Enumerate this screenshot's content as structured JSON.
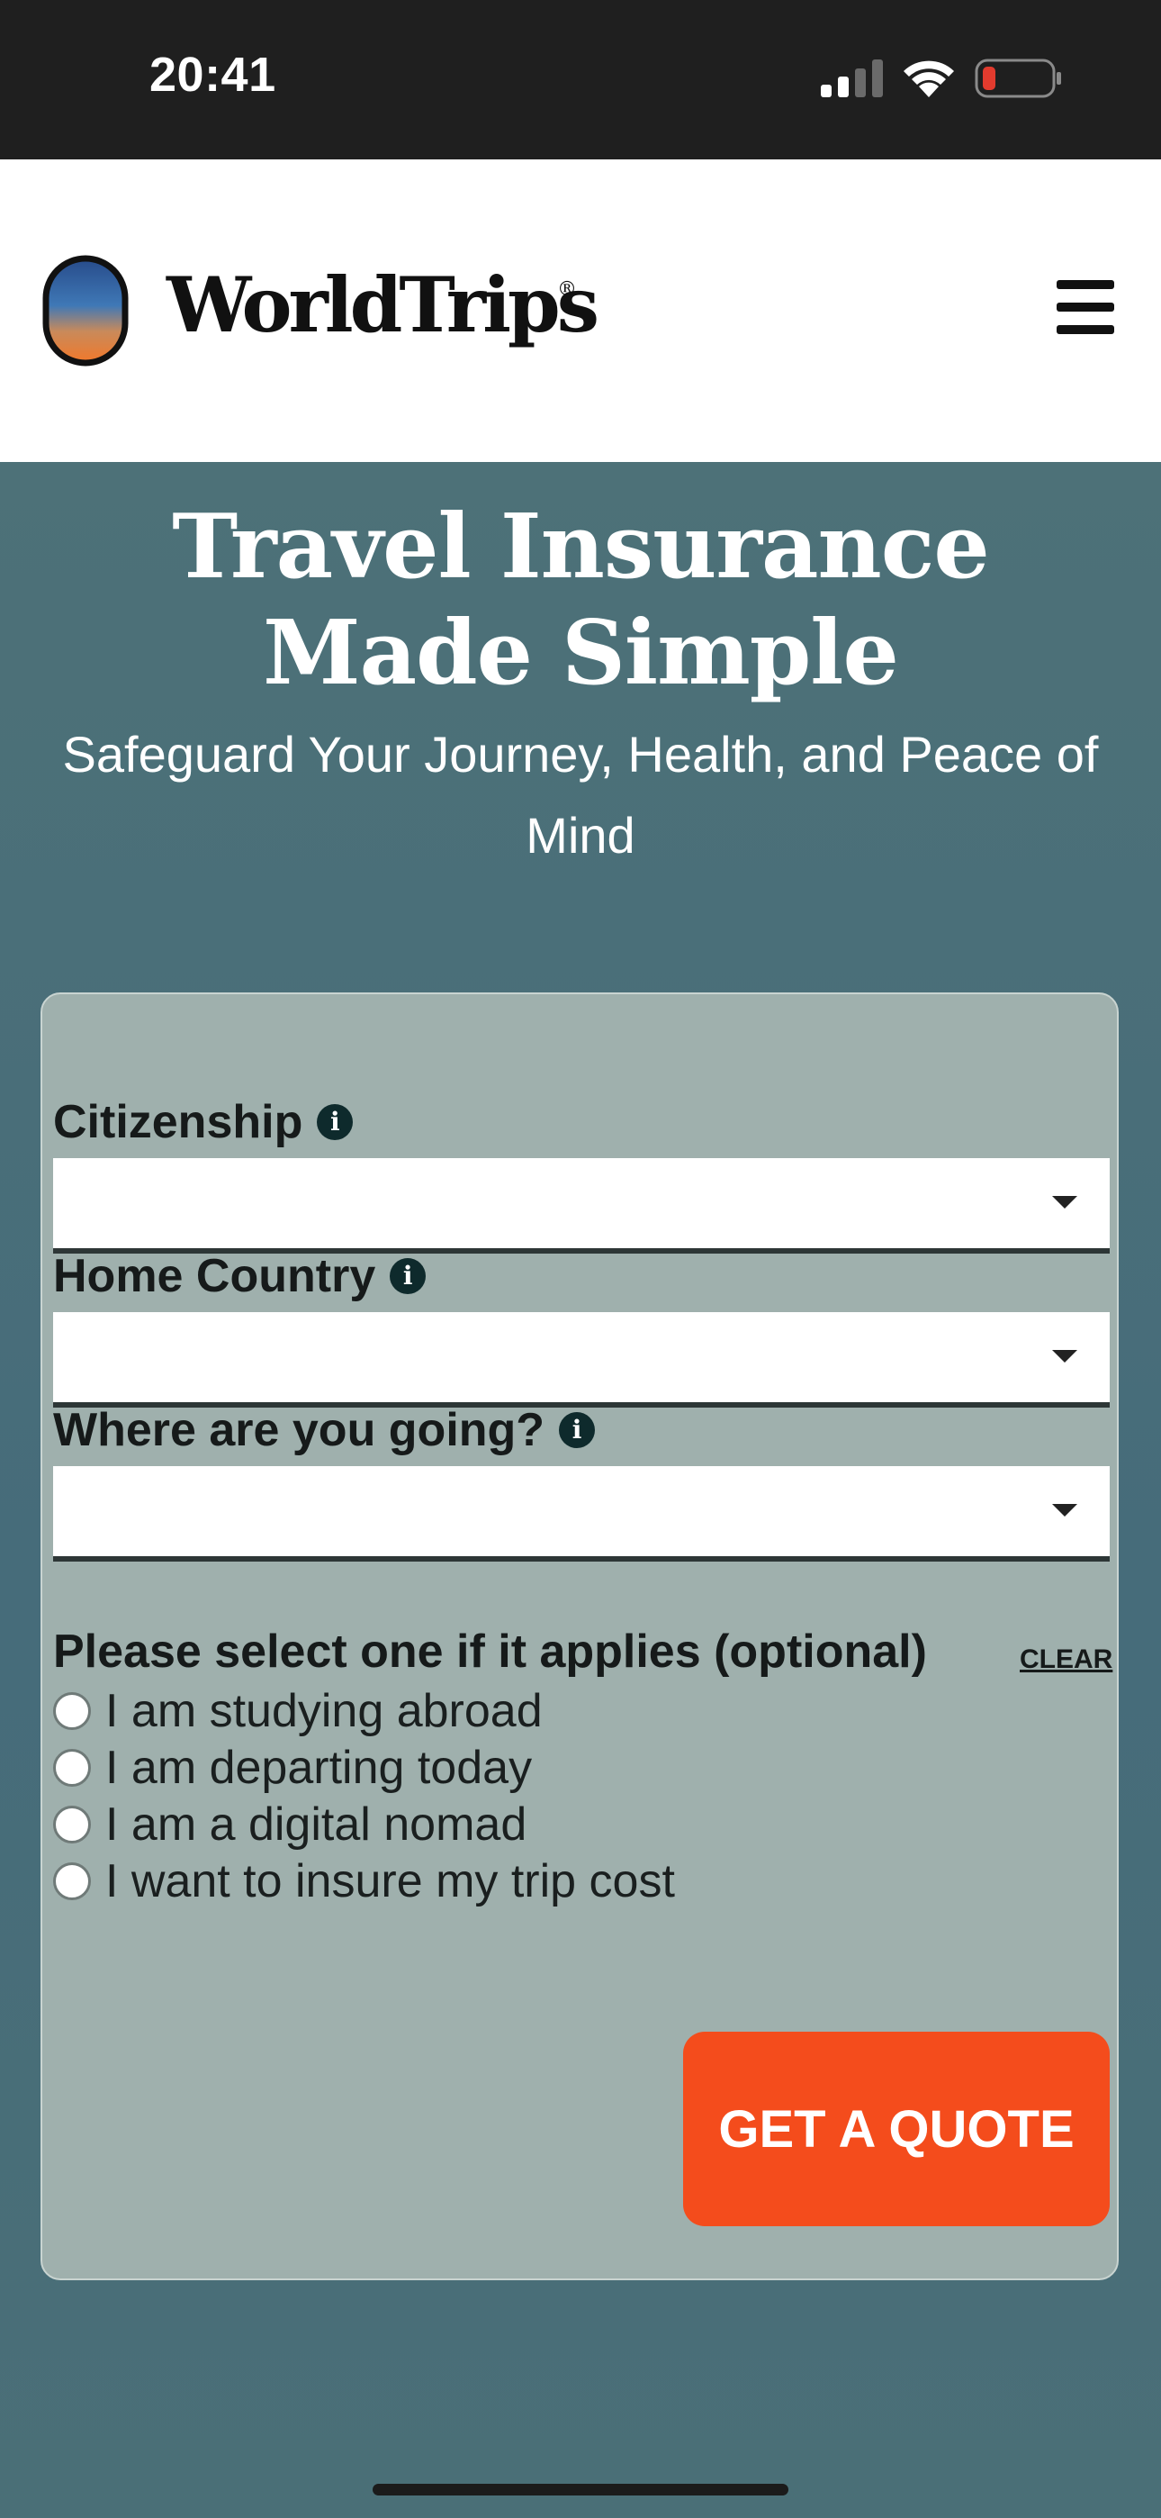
{
  "status_bar": {
    "time": "20:41",
    "icons": [
      "signal-icon",
      "wifi-icon",
      "battery-icon"
    ],
    "battery_low_color": "#e23b2e"
  },
  "header": {
    "brand_name": "WorldTrips",
    "brand_mark": "®",
    "logo_icon": "capsule-sunset-logo",
    "menu_icon": "hamburger-menu-icon"
  },
  "hero": {
    "title": "Travel Insurance Made Simple",
    "subtitle": "Safeguard Your Journey, Health, and Peace of Mind"
  },
  "form": {
    "fields": [
      {
        "label": "Citizenship",
        "value": "",
        "info_icon": "info-icon"
      },
      {
        "label": "Home Country",
        "value": "",
        "info_icon": "info-icon"
      },
      {
        "label": "Where are you going?",
        "value": "",
        "info_icon": "info-icon"
      }
    ],
    "options_heading": "Please select one if it applies (optional)",
    "clear_label": "CLEAR",
    "options": [
      {
        "label": "I am studying abroad",
        "selected": false
      },
      {
        "label": "I am departing today",
        "selected": false
      },
      {
        "label": "I am a digital nomad",
        "selected": false
      },
      {
        "label": "I want to insure my trip cost",
        "selected": false
      }
    ],
    "submit_label": "GET A QUOTE"
  },
  "colors": {
    "accent": "#f44c1c",
    "hero_background": "#466e74",
    "card_background": "#9fb0ad"
  }
}
